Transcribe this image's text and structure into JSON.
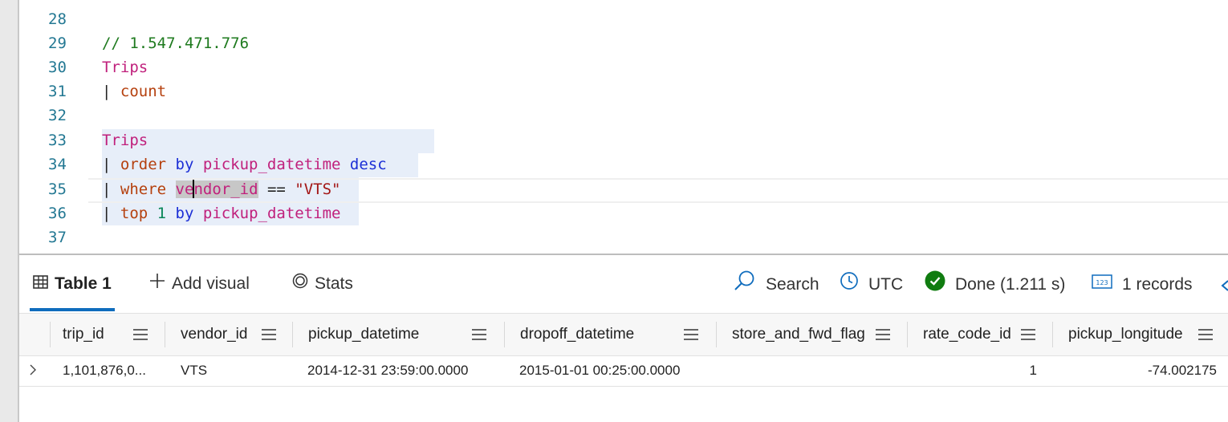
{
  "editor": {
    "lines": [
      {
        "num": "28"
      },
      {
        "num": "29",
        "comment": "// 1.547.471.776"
      },
      {
        "num": "30",
        "table": "Trips"
      },
      {
        "num": "31",
        "pipe": "| ",
        "op": "count"
      },
      {
        "num": "32"
      },
      {
        "num": "33",
        "table": "Trips"
      },
      {
        "num": "34",
        "pipe": "| ",
        "op": "order",
        "kw1": " by ",
        "col": "pickup_datetime",
        "kw2": " desc"
      },
      {
        "num": "35",
        "pipe": "| ",
        "op": "where",
        "col_a": "ve",
        "col_b": "ndor_id",
        "eq": " == ",
        "str": "\"VTS\""
      },
      {
        "num": "36",
        "pipe": "| ",
        "op": "top",
        "n": " 1",
        "kw1": " by ",
        "col": "pickup_datetime"
      },
      {
        "num": "37"
      }
    ]
  },
  "results": {
    "tabs": [
      {
        "label": "Table 1"
      },
      {
        "label": "Add visual"
      },
      {
        "label": "Stats"
      }
    ],
    "toolbar": {
      "search_label": "Search",
      "timezone_label": "UTC",
      "status_label": "Done (1.211 s)",
      "records_label": "1 records"
    },
    "columns": [
      "trip_id",
      "vendor_id",
      "pickup_datetime",
      "dropoff_datetime",
      "store_and_fwd_flag",
      "rate_code_id",
      "pickup_longitude"
    ],
    "rows": [
      {
        "trip_id": "1,101,876,0...",
        "vendor_id": "VTS",
        "pickup_datetime": "2014-12-31 23:59:00.0000",
        "dropoff_datetime": "2015-01-01 00:25:00.0000",
        "store_and_fwd_flag": "",
        "rate_code_id": "1",
        "pickup_longitude": "-74.002175"
      }
    ]
  },
  "colors": {
    "accent": "#0f6cbd",
    "status_ok": "#107c10",
    "line_number": "#237893"
  },
  "icons": [
    "table-icon",
    "plus-icon",
    "stats-icon",
    "search-icon",
    "clock-icon",
    "check-circle-icon",
    "number-123-icon",
    "chevron-right-icon",
    "column-menu-icon"
  ]
}
